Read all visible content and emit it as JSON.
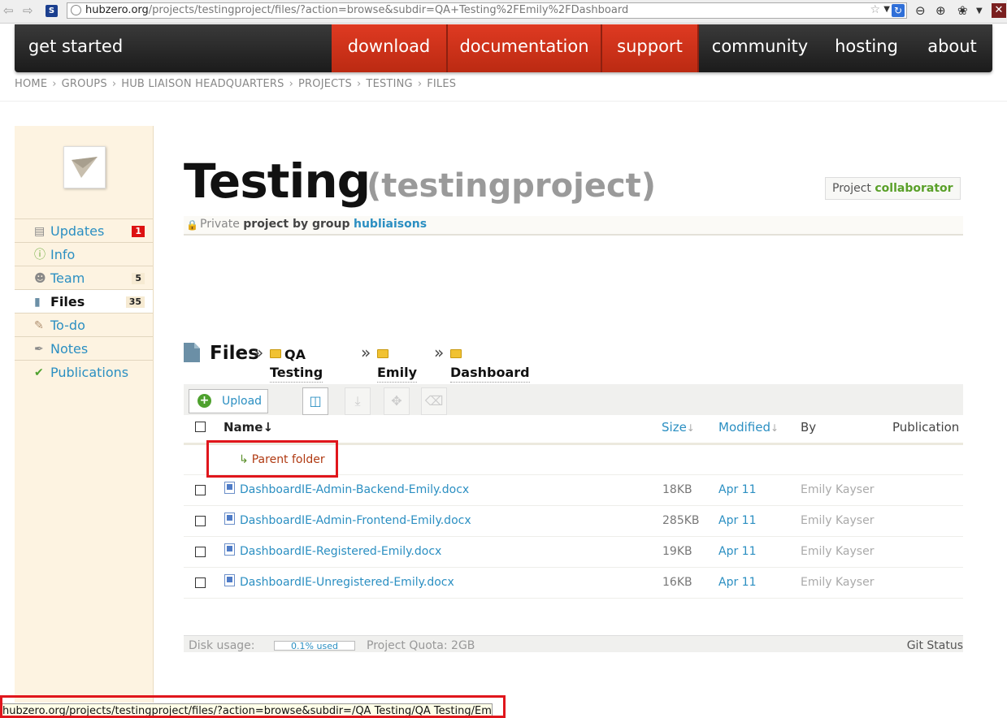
{
  "browser": {
    "url_host": "hubzero.org",
    "url_path": "/projects/testingproject/files/?action=browse&subdir=QA+Testing%2FEmily%2FDashboard"
  },
  "site_nav": {
    "items": [
      {
        "label": "get started"
      },
      {
        "label": "download"
      },
      {
        "label": "documentation"
      },
      {
        "label": "support"
      },
      {
        "label": "community"
      },
      {
        "label": "hosting"
      },
      {
        "label": "about"
      }
    ]
  },
  "breadcrumb": [
    "HOME",
    "GROUPS",
    "HUB LIAISON HEADQUARTERS",
    "PROJECTS",
    "TESTING",
    "FILES"
  ],
  "sidebar": {
    "items": [
      {
        "label": "Updates",
        "count": "1",
        "icon": "updates-icon"
      },
      {
        "label": "Info",
        "count": "",
        "icon": "info-icon"
      },
      {
        "label": "Team",
        "count": "5",
        "icon": "team-icon"
      },
      {
        "label": "Files",
        "count": "35",
        "icon": "file-icon"
      },
      {
        "label": "To-do",
        "count": "",
        "icon": "todo-icon"
      },
      {
        "label": "Notes",
        "count": "",
        "icon": "quill-icon"
      },
      {
        "label": "Publications",
        "count": "",
        "icon": "check-icon"
      }
    ]
  },
  "project": {
    "title": "Testing",
    "alias": "(testingproject)",
    "role_prefix": "Project",
    "role": "collaborator",
    "privacy": "Private",
    "by_group_text": "project by group",
    "group": "hubliaisons"
  },
  "files": {
    "heading": "Files",
    "path": [
      "QA Testing",
      "Emily",
      "Dashboard"
    ],
    "toolbar": {
      "upload_label": "Upload"
    },
    "columns": {
      "name": "Name",
      "size": "Size",
      "modified": "Modified",
      "by": "By",
      "publication": "Publication"
    },
    "parent_folder_label": "Parent folder",
    "rows": [
      {
        "name": "DashboardIE-Admin-Backend-Emily.docx",
        "size": "18KB",
        "modified": "Apr 11",
        "by": "Emily Kayser"
      },
      {
        "name": "DashboardIE-Admin-Frontend-Emily.docx",
        "size": "285KB",
        "modified": "Apr 11",
        "by": "Emily Kayser"
      },
      {
        "name": "DashboardIE-Registered-Emily.docx",
        "size": "19KB",
        "modified": "Apr 11",
        "by": "Emily Kayser"
      },
      {
        "name": "DashboardIE-Unregistered-Emily.docx",
        "size": "16KB",
        "modified": "Apr 11",
        "by": "Emily Kayser"
      }
    ],
    "disk_usage_label": "Disk usage:",
    "disk_usage_value": "0.1% used",
    "quota_label": "Project Quota: 2GB",
    "git_status_label": "Git Status"
  },
  "status_bar": {
    "text": "hubzero.org/projects/testingproject/files/?action=browse&subdir=/QA Testing/QA Testing/Emily"
  },
  "colors": {
    "accent_red": "#d6381e",
    "link_blue": "#2b8fc2",
    "highlight_red": "#e0161c"
  }
}
